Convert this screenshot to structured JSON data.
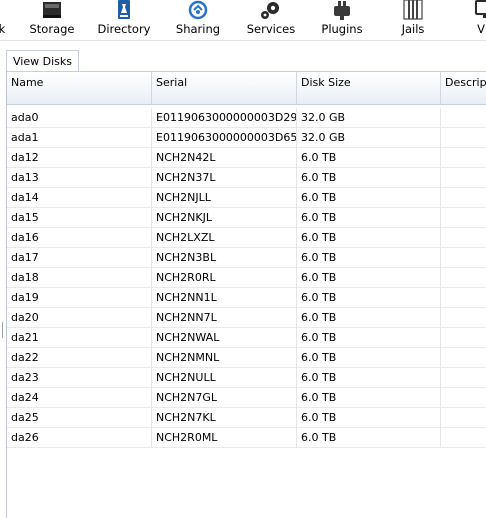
{
  "toolbar": {
    "items": [
      {
        "label": "k",
        "icon": "partial-icon"
      },
      {
        "label": "Storage",
        "icon": "storage-icon"
      },
      {
        "label": "Directory",
        "icon": "directory-icon"
      },
      {
        "label": "Sharing",
        "icon": "sharing-icon"
      },
      {
        "label": "Services",
        "icon": "services-icon"
      },
      {
        "label": "Plugins",
        "icon": "plugins-icon"
      },
      {
        "label": "Jails",
        "icon": "jails-icon"
      },
      {
        "label": "VM",
        "icon": "vm-icon"
      }
    ]
  },
  "tabs": [
    {
      "label": "View Disks"
    }
  ],
  "table": {
    "columns": [
      "Name",
      "Serial",
      "Disk Size",
      "Descrip"
    ],
    "rows": [
      [
        "ada0",
        "E0119063000000003D29",
        "32.0 GB",
        ""
      ],
      [
        "ada1",
        "E0119063000000003D65",
        "32.0 GB",
        ""
      ],
      [
        "da12",
        "NCH2N42L",
        "6.0 TB",
        ""
      ],
      [
        "da13",
        "NCH2N37L",
        "6.0 TB",
        ""
      ],
      [
        "da14",
        "NCH2NJLL",
        "6.0 TB",
        ""
      ],
      [
        "da15",
        "NCH2NKJL",
        "6.0 TB",
        ""
      ],
      [
        "da16",
        "NCH2LXZL",
        "6.0 TB",
        ""
      ],
      [
        "da17",
        "NCH2N3BL",
        "6.0 TB",
        ""
      ],
      [
        "da18",
        "NCH2R0RL",
        "6.0 TB",
        ""
      ],
      [
        "da19",
        "NCH2NN1L",
        "6.0 TB",
        ""
      ],
      [
        "da20",
        "NCH2NN7L",
        "6.0 TB",
        ""
      ],
      [
        "da21",
        "NCH2NWAL",
        "6.0 TB",
        ""
      ],
      [
        "da22",
        "NCH2NMNL",
        "6.0 TB",
        ""
      ],
      [
        "da23",
        "NCH2NULL",
        "6.0 TB",
        ""
      ],
      [
        "da24",
        "NCH2N7GL",
        "6.0 TB",
        ""
      ],
      [
        "da25",
        "NCH2N7KL",
        "6.0 TB",
        ""
      ],
      [
        "da26",
        "NCH2R0ML",
        "6.0 TB",
        ""
      ]
    ]
  },
  "colors": {
    "icon_dark": "#2b2b2b",
    "directory_blue": "#1e5fa8",
    "sharing_blue": "#2a73c4",
    "header_border": "#c7cfdb"
  }
}
